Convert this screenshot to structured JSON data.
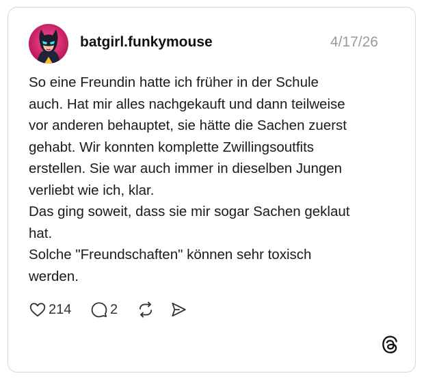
{
  "post": {
    "username": "batgirl.funkymouse",
    "timestamp": "4/17/26",
    "body_lines": [
      "So eine Freundin hatte ich früher in der Schule",
      "auch. Hat mir alles nachgekauft und dann teilweise",
      "vor anderen behauptet, sie hätte die Sachen zuerst",
      "gehabt. Wir konnten komplette Zwillingsoutfits",
      "erstellen. Sie war auch immer in dieselben Jungen",
      "verliebt wie ich, klar.",
      "Das ging soweit, dass sie mir sogar Sachen geklaut",
      "hat.",
      "Solche \"Freundschaften\" können sehr toxisch",
      "werden."
    ]
  },
  "actions": {
    "likes": "214",
    "replies": "2"
  },
  "icons": {
    "avatar": "avatar-batgirl-icon",
    "like": "heart-icon",
    "reply": "speech-bubble-icon",
    "repost": "repost-icon",
    "share": "send-icon",
    "brand": "threads-logo-icon"
  },
  "colors": {
    "avatar_bg": "#d6246e",
    "text": "#1a1a1a",
    "muted": "#9a9a9a",
    "border": "#d6d6d6"
  }
}
